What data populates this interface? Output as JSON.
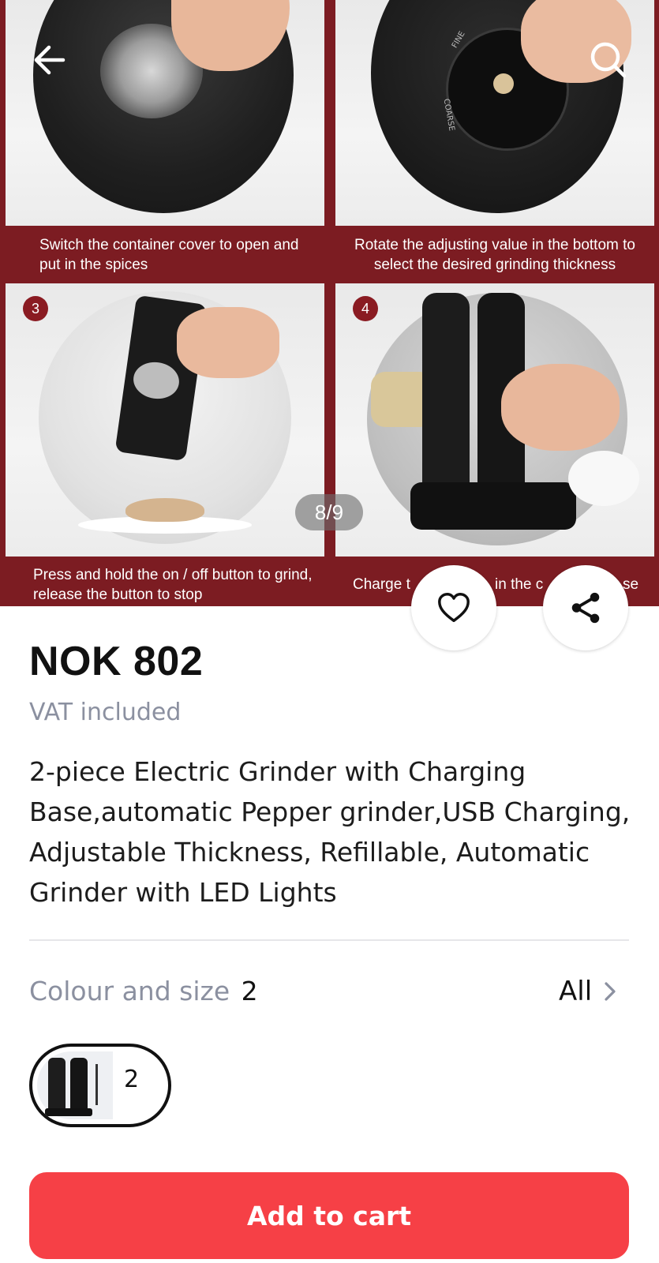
{
  "gallery": {
    "captions": [
      "Switch the container cover to open and put in the spices",
      "Rotate the adjusting value in the bottom to select the desired grinding thickness",
      "Press and hold the on / off button to grind, release the button to stop",
      "Charge t"
    ],
    "caption4_tail_a": "in the c",
    "caption4_tail_b": "se",
    "step_badges": [
      "3",
      "4"
    ],
    "counter": "8/9",
    "dial_labels": {
      "fine": "FINE",
      "coarse": "COARSE"
    }
  },
  "top_bar": {
    "back_icon": "back-arrow-icon",
    "search_icon": "search-icon"
  },
  "actions": {
    "favorite_icon": "heart-icon",
    "share_icon": "share-icon"
  },
  "product": {
    "price": "NOK 802",
    "vat": "VAT included",
    "title": "2-piece Electric Grinder with Charging Base,automatic Pepper grinder,USB Charging, Adjustable Thickness, Refillable, Automatic Grinder with LED Lights"
  },
  "variants": {
    "label": "Colour and size",
    "count": "2",
    "all_label": "All",
    "chip_count": "2"
  },
  "cart": {
    "label": "Add to cart"
  },
  "colors": {
    "gallery_bg": "#7c1c22",
    "accent": "#f64046",
    "muted": "#8b90a0"
  }
}
